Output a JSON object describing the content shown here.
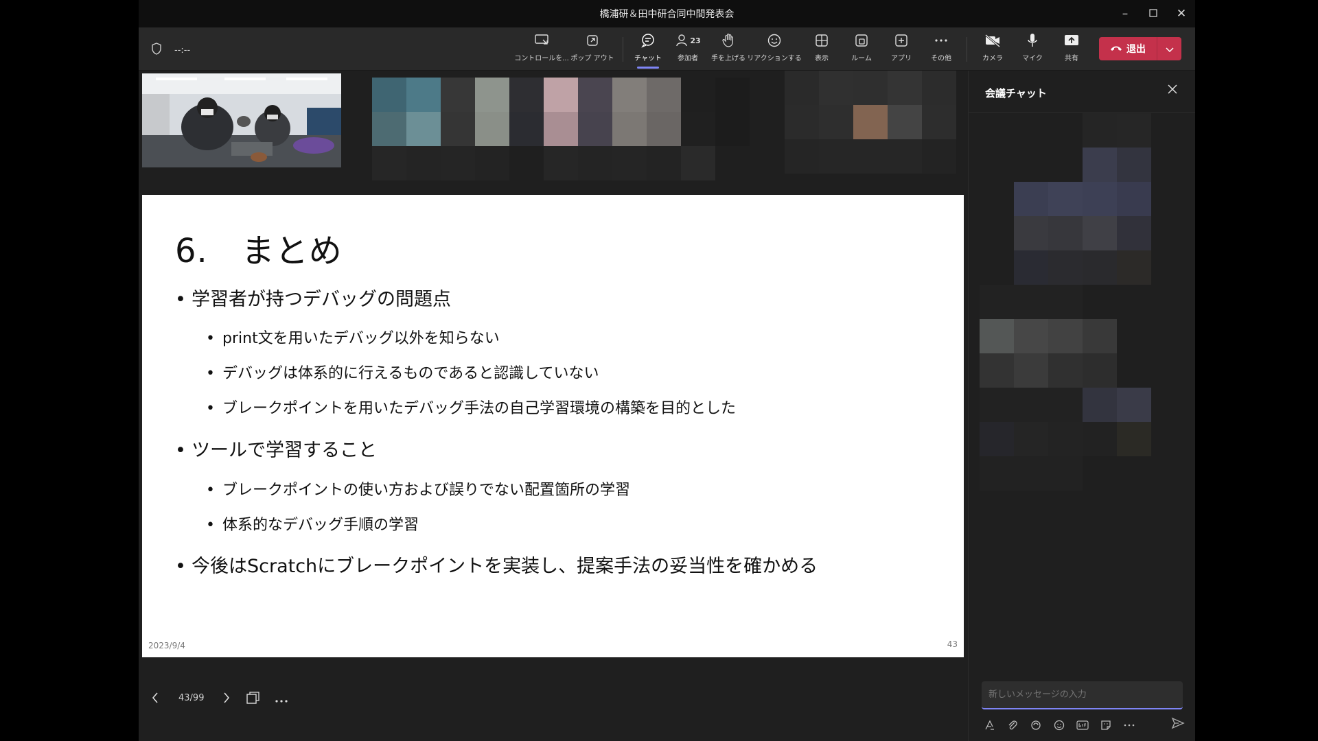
{
  "window": {
    "title": "橋浦研＆田中研合同中間発表会"
  },
  "toolbar": {
    "timer": "--:--",
    "buttons": [
      {
        "label": "コントロールを..."
      },
      {
        "label": "ポップ アウト"
      },
      {
        "label": "チャット"
      },
      {
        "label": "参加者",
        "count": "23"
      },
      {
        "label": "手を上げる"
      },
      {
        "label": "リアクションする"
      },
      {
        "label": "表示"
      },
      {
        "label": "ルーム"
      },
      {
        "label": "アプリ"
      },
      {
        "label": "その他"
      },
      {
        "label": "カメラ"
      },
      {
        "label": "マイク"
      },
      {
        "label": "共有"
      }
    ],
    "leave_label": "退出",
    "leave_color": "#c4314b",
    "active_accent": "#7f85f5"
  },
  "slide": {
    "title": "6.　まとめ",
    "bullets": [
      "学習者が持つデバッグの問題点",
      "ツールで学習すること",
      "今後はScratchにブレークポイントを実装し、提案手法の妥当性を確かめる"
    ],
    "sub1": [
      "print文を用いたデバッグ以外を知らない",
      "デバッグは体系的に行えるものであると認識していない",
      "ブレークポイントを用いたデバッグ手法の自己学習環境の構築を目的とした"
    ],
    "sub2": [
      "ブレークポイントの使い方および誤りでない配置箇所の学習",
      "体系的なデバッグ手順の学習"
    ],
    "date": "2023/9/4",
    "page": "43"
  },
  "slide_nav": {
    "position": "43/99"
  },
  "chat": {
    "title": "会議チャット",
    "input_placeholder": "新しいメッセージの入力"
  }
}
